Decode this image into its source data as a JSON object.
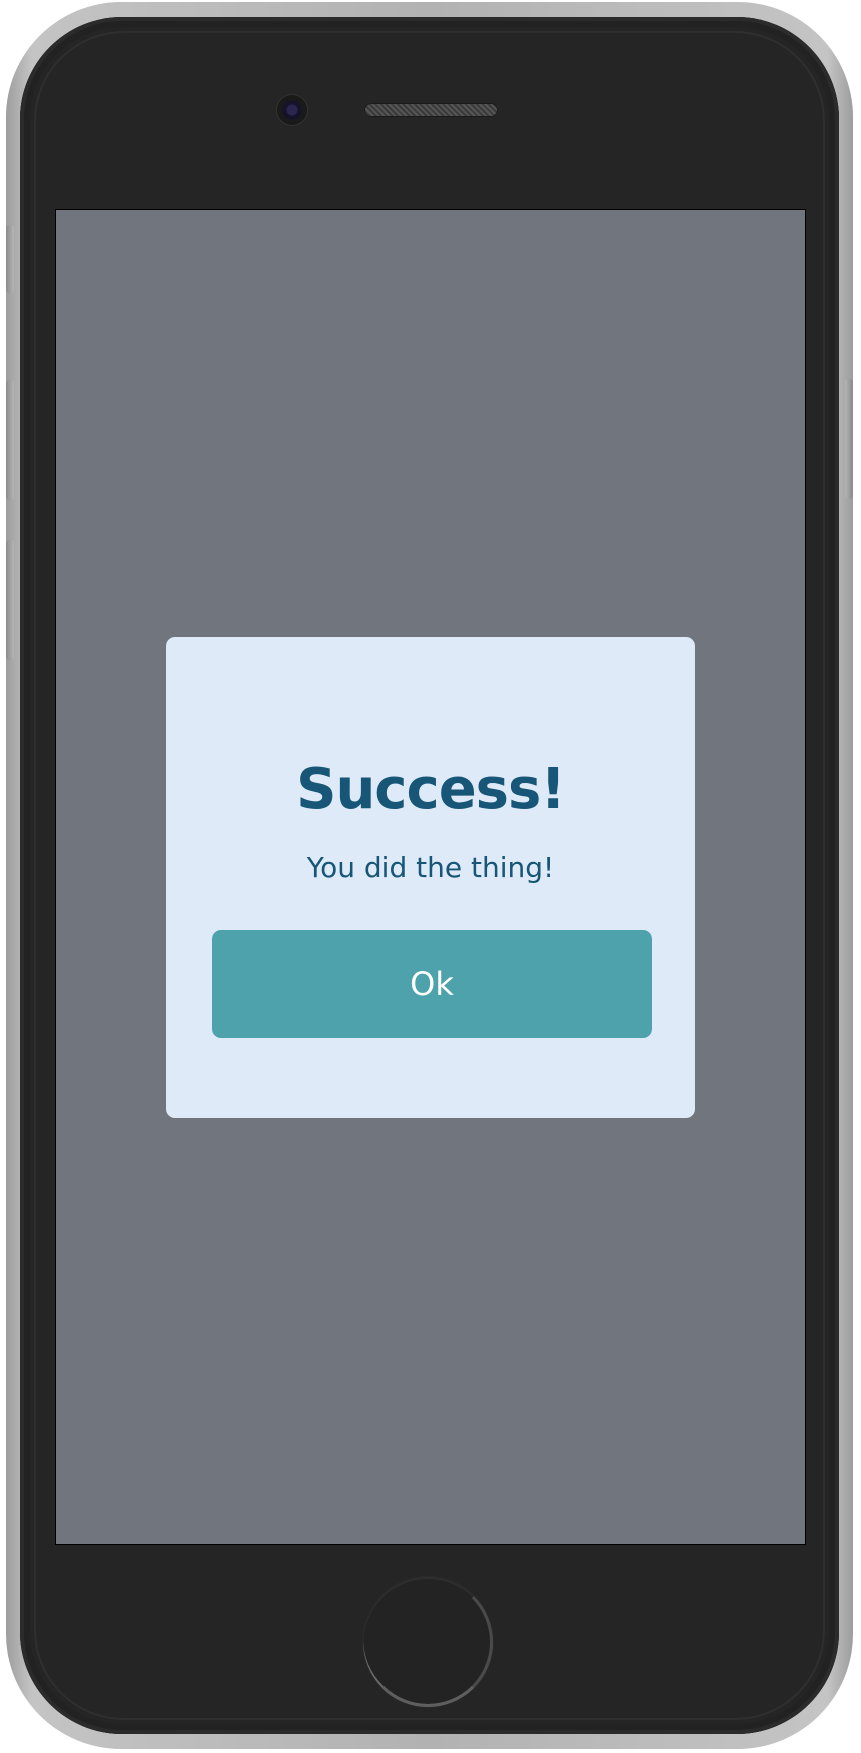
{
  "dialog": {
    "title": "Success!",
    "message": "You did the thing!",
    "ok_label": "Ok"
  },
  "colors": {
    "overlay_background": "#71757d",
    "dialog_background": "#deeaf7",
    "text_primary": "#175676",
    "button_background": "#4ea2ab",
    "button_text": "#ffffff",
    "device_body": "#252525"
  },
  "icons": {
    "camera": "front-camera-icon",
    "speaker": "earpiece-speaker-icon",
    "home": "home-button-icon"
  }
}
